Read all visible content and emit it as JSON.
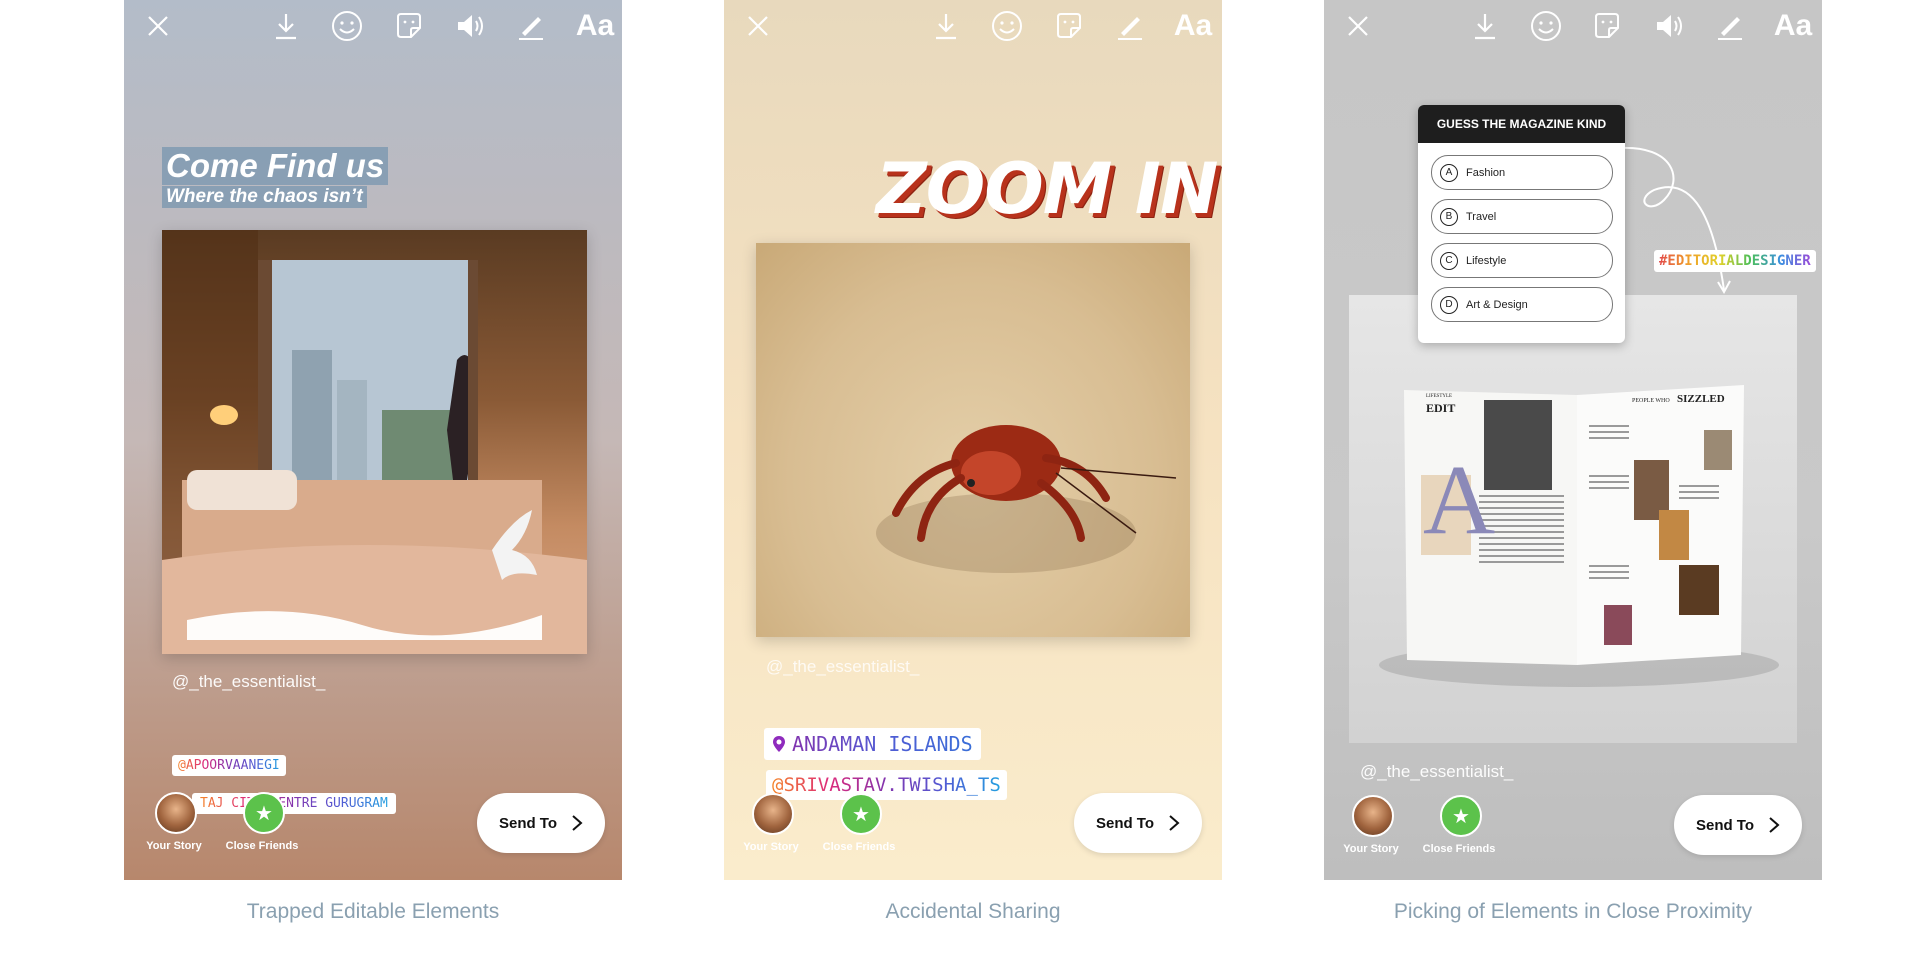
{
  "toolbar": {
    "icons": [
      "close-icon",
      "download-icon",
      "face-effects-icon",
      "sticker-icon",
      "sound-icon",
      "draw-icon",
      "text-icon"
    ],
    "text_label": "Aa"
  },
  "panels": [
    {
      "caption": "Trapped Editable Elements",
      "title": "Come Find us",
      "subtitle": "Where the chaos isn’t",
      "handle": "@_the_essentialist_",
      "mention": "@APOORVAANEGI",
      "location": "TAJ CITY CENTRE GURUGRAM",
      "your_story": "Your Story",
      "close_friends": "Close Friends",
      "send_to": "Send To"
    },
    {
      "caption": "Accidental Sharing",
      "title": "ZOOM IN",
      "handle": "@_the_essentialist_",
      "location": "ANDAMAN ISLANDS",
      "mention": "@SRIVASTAV.TWISHA_TS",
      "your_story": "Your Story",
      "close_friends": "Close Friends",
      "send_to": "Send To"
    },
    {
      "caption": "Picking of Elements in Close Proximity",
      "poll_question": "GUESS THE MAGAZINE KIND",
      "poll_options": [
        {
          "letter": "A",
          "text": "Fashion"
        },
        {
          "letter": "B",
          "text": "Travel"
        },
        {
          "letter": "C",
          "text": "Lifestyle"
        },
        {
          "letter": "D",
          "text": "Art & Design"
        }
      ],
      "hashtag": "#EDITORIALDESIGNER",
      "handle": "@_the_essentialist_",
      "your_story": "Your Story",
      "close_friends": "Close Friends",
      "send_to": "Send To",
      "magazine": {
        "left_head": "EDIT",
        "left_kicker": "LIFESTYLE",
        "big_letter": "A",
        "right_kicker": "PEOPLE WHO",
        "right_head": "SIZZLED"
      }
    }
  ]
}
